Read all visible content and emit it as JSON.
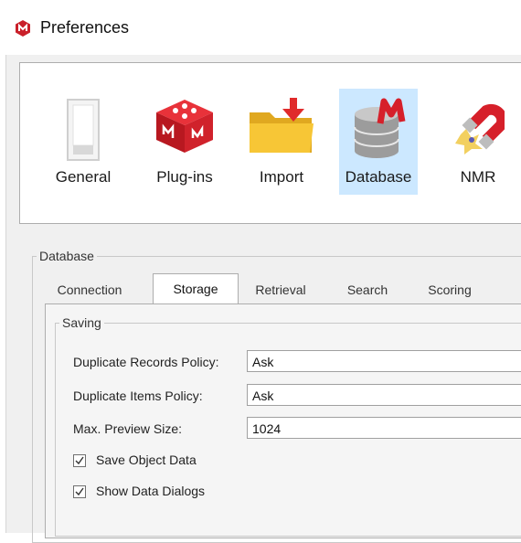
{
  "window": {
    "title": "Preferences"
  },
  "toolbar": {
    "items": [
      {
        "label": "General",
        "icon": "general-switch-icon"
      },
      {
        "label": "Plug-ins",
        "icon": "plugins-cube-icon"
      },
      {
        "label": "Import",
        "icon": "import-folder-icon"
      },
      {
        "label": "Database",
        "icon": "database-icon",
        "selected": true
      },
      {
        "label": "NMR",
        "icon": "nmr-magnet-icon"
      }
    ]
  },
  "database_group": {
    "legend": "Database"
  },
  "tabs": [
    {
      "label": "Connection"
    },
    {
      "label": "Storage",
      "selected": true
    },
    {
      "label": "Retrieval"
    },
    {
      "label": "Search"
    },
    {
      "label": "Scoring"
    }
  ],
  "saving": {
    "legend": "Saving",
    "duplicate_records": {
      "label": "Duplicate Records Policy:",
      "value": "Ask"
    },
    "duplicate_items": {
      "label": "Duplicate Items Policy:",
      "value": "Ask"
    },
    "max_preview": {
      "label": "Max. Preview Size:",
      "value": "1024"
    },
    "save_object_data": {
      "label": "Save Object Data",
      "checked": true
    },
    "show_data_dialogs": {
      "label": "Show Data Dialogs",
      "checked": true
    }
  },
  "colors": {
    "selected_bg": "#cce8ff",
    "brand_red": "#d6202a"
  }
}
